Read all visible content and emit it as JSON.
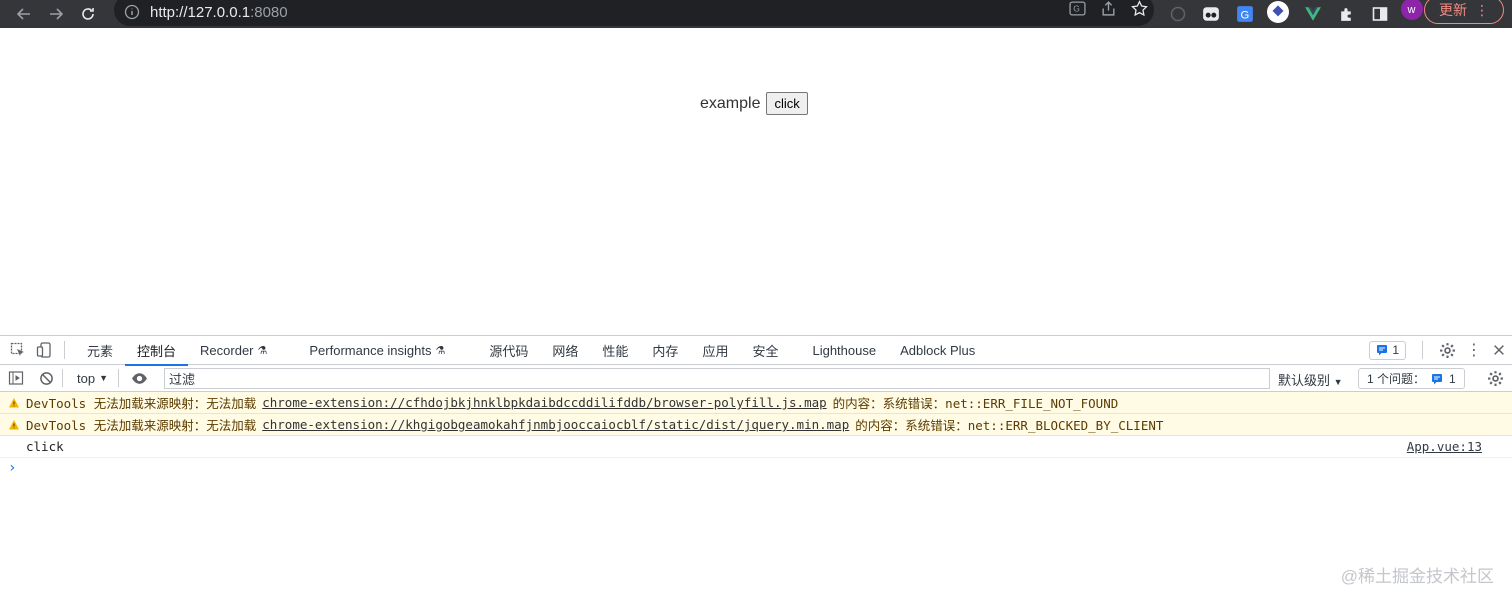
{
  "browser": {
    "url_host": "http://127.0.0.1",
    "url_port": ":8080",
    "update_label": "更新"
  },
  "page": {
    "example_text": "example",
    "button_label": "click"
  },
  "devtools": {
    "tabs": [
      {
        "label": "元素"
      },
      {
        "label": "控制台",
        "active": true
      },
      {
        "label": "Recorder"
      },
      {
        "label": "Performance insights"
      },
      {
        "label": "源代码"
      },
      {
        "label": "网络"
      },
      {
        "label": "性能"
      },
      {
        "label": "内存"
      },
      {
        "label": "应用"
      },
      {
        "label": "安全"
      },
      {
        "label": "Lighthouse"
      },
      {
        "label": "Adblock Plus"
      }
    ],
    "issues_badge": "1",
    "context": "top",
    "filter_placeholder": "过滤",
    "level_label": "默认级别",
    "issues_label": "1 个问题：",
    "issues_count": "1",
    "messages": [
      {
        "type": "warn",
        "prefix": "DevTools 无法加载来源映射：无法加载",
        "link": "chrome-extension://cfhdojbkjhnklbpkdaibdccddilifddb/browser-polyfill.js.map",
        "suffix": "的内容：系统错误：net::ERR_FILE_NOT_FOUND"
      },
      {
        "type": "warn",
        "prefix": "DevTools 无法加载来源映射：无法加载",
        "link": "chrome-extension://khgigobgeamokahfjnmbjooccaiocblf/static/dist/jquery.min.map",
        "suffix": "的内容：系统错误：net::ERR_BLOCKED_BY_CLIENT"
      }
    ],
    "log_text": "click",
    "log_source": "App.vue:13"
  },
  "watermark": "@稀土掘金技术社区",
  "colors": {
    "toolbar": "#35363a",
    "accent": "#1a73e8",
    "warn_bg": "#fffbe5"
  }
}
